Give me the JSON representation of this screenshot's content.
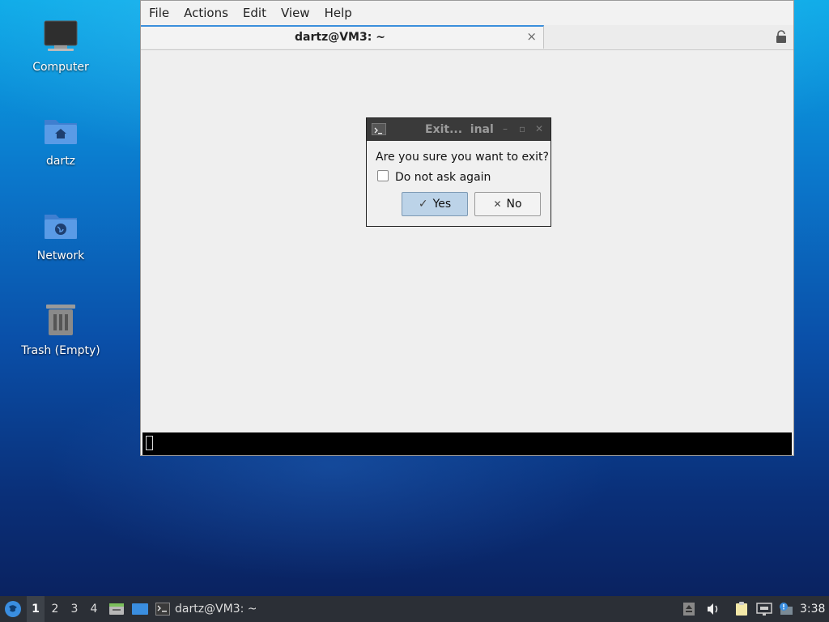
{
  "desktop": {
    "icons": [
      {
        "label": "Computer"
      },
      {
        "label": "dartz"
      },
      {
        "label": "Network"
      },
      {
        "label": "Trash (Empty)"
      }
    ]
  },
  "terminal": {
    "menu": [
      "File",
      "Actions",
      "Edit",
      "View",
      "Help"
    ],
    "tab_title": "dartz@VM3: ~",
    "tab_close": "×"
  },
  "dialog": {
    "title": "Exit...  inal",
    "question": "Are you sure you want to exit?",
    "checkbox_label": "Do not ask again",
    "checkbox_checked": false,
    "yes_label": "Yes",
    "no_label": "No",
    "yes_glyph": "✓",
    "no_glyph": "✕",
    "min_glyph": "–",
    "max_glyph": "▫",
    "close_glyph": "✕"
  },
  "taskbar": {
    "workspaces": [
      "1",
      "2",
      "3",
      "4"
    ],
    "active_workspace": "1",
    "task_title": "dartz@VM3: ~",
    "clock": "3:38"
  },
  "colors": {
    "accent": "#3b8fdc",
    "taskbar_bg": "#2b2f36",
    "dialog_titlebar": "#3a3a3a"
  }
}
